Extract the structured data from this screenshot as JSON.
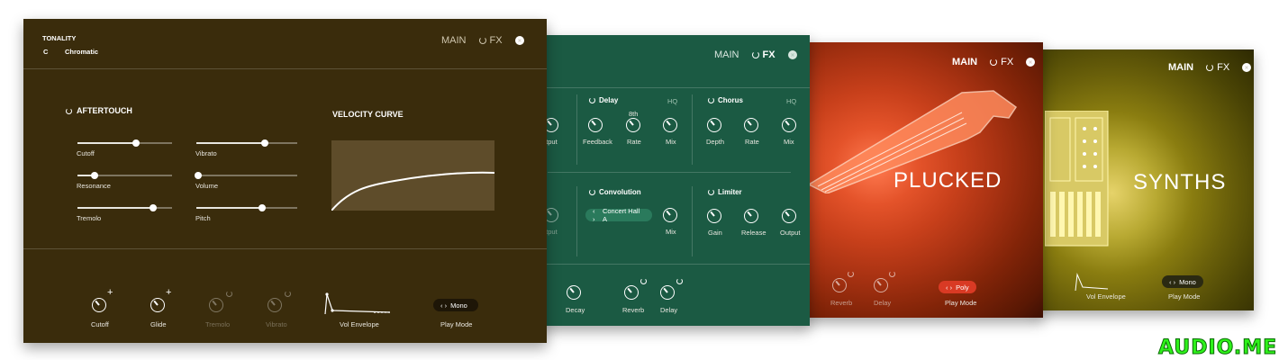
{
  "main_panel": {
    "tonality_label": "TONALITY",
    "key": "C",
    "scale": "Chromatic",
    "tabs": {
      "main": "MAIN",
      "fx": "FX"
    },
    "aftertouch_title": "AFTERTOUCH",
    "velocity_title": "VELOCITY CURVE",
    "sliders": [
      {
        "label": "Cutoff",
        "value": 0.62
      },
      {
        "label": "Vibrato",
        "value": 0.68
      },
      {
        "label": "Resonance",
        "value": 0.18
      },
      {
        "label": "Volume",
        "value": 0.02
      },
      {
        "label": "Tremolo",
        "value": 0.8
      },
      {
        "label": "Pitch",
        "value": 0.65
      }
    ],
    "bottom_knobs": [
      {
        "label": "Cutoff",
        "active": true
      },
      {
        "label": "Glide",
        "active": true
      },
      {
        "label": "Tremolo",
        "active": false
      },
      {
        "label": "Vibrato",
        "active": false
      }
    ],
    "envelope_label": "Vol Envelope",
    "play_mode_value": "Mono",
    "play_mode_label": "Play Mode"
  },
  "fx_panel": {
    "tabs": {
      "main": "MAIN",
      "fx": "FX"
    },
    "delay": {
      "title": "Delay",
      "hq": "HQ",
      "rate_value": "8th",
      "knobs": [
        "Feedback",
        "Rate",
        "Mix"
      ]
    },
    "chorus": {
      "title": "Chorus",
      "hq": "HQ",
      "knobs": [
        "Depth",
        "Rate",
        "Mix"
      ]
    },
    "output_partial": "utput",
    "output_partial2": "utput",
    "convolution": {
      "title": "Convolution",
      "preset": "Concert Hall A",
      "knobs": [
        "Mix"
      ]
    },
    "limiter": {
      "title": "Limiter",
      "knobs": [
        "Gain",
        "Release",
        "Output"
      ]
    },
    "bottom_knobs": [
      "Decay",
      "Reverb",
      "Delay"
    ]
  },
  "plucked_panel": {
    "tabs": {
      "main": "MAIN",
      "fx": "FX"
    },
    "title": "PLUCKED",
    "knobs": [
      "Reverb",
      "Delay"
    ],
    "play_mode_value": "Poly",
    "play_mode_label": "Play Mode"
  },
  "synths_panel": {
    "tabs": {
      "main": "MAIN",
      "fx": "FX"
    },
    "title": "SYNTHS",
    "envelope_label": "Vol Envelope",
    "play_mode_value": "Mono",
    "play_mode_label": "Play Mode"
  },
  "watermark": "AUDIO.ME",
  "colors": {
    "main_bg": "#3a2c0c",
    "fx_bg": "#1b5a43",
    "plucked_bg": "#c9421e",
    "synths_bg": "#5a5208"
  }
}
